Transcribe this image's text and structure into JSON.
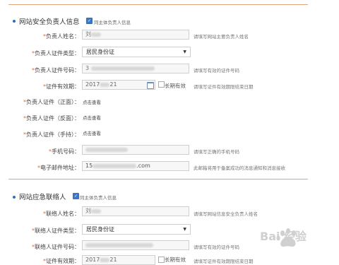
{
  "section1": {
    "title": "网站安全负责人信息",
    "checkbox_label": "同主体负责人信息",
    "fields": {
      "name": {
        "label": "负责人姓名：",
        "value": "刘",
        "hint": "请填写网站主要负责人姓名"
      },
      "id_type": {
        "label": "负责人证件类型：",
        "value": "居民身份证"
      },
      "id_number": {
        "label": "负责人证件号码：",
        "value": "3",
        "hint": "请填写有效的证件号码"
      },
      "valid_until": {
        "label": "证件有效期：",
        "value": "2017",
        "value_suffix": "21",
        "long_term_label": "长期有效",
        "hint": "请填写证件有效期限结束日期"
      },
      "id_front": {
        "label": "负责人证件（正面）：",
        "link": "点击查看"
      },
      "id_back": {
        "label": "负责人证件（反面）：",
        "link": "点击查看"
      },
      "id_hand": {
        "label": "负责人证件（手持）：",
        "link": "点击查看"
      },
      "phone": {
        "label": "手机号码：",
        "hint": "请填写正确的手机号码"
      },
      "email": {
        "label": "电子邮件地址：",
        "value_prefix": "15",
        "value_suffix": ".com",
        "hint": "此邮箱将用于备案成功的消息通知和消息接收"
      }
    }
  },
  "section2": {
    "title": "网站应急联络人",
    "checkbox_label": "同主体负责人信息",
    "fields": {
      "name": {
        "label": "联络人姓名：",
        "value": "刘",
        "hint": "请填写网站信息安全负责人姓名"
      },
      "id_type": {
        "label": "联络人证件类型：",
        "value": "居民身份证"
      },
      "id_number": {
        "label": "联络人证件号码：",
        "hint": "请填写有效的证件号码"
      },
      "valid_until": {
        "label": "证件有效期：",
        "value": "2017",
        "value_suffix": "21",
        "long_term_label": "长期有效",
        "hint": "请填写证件有效期限结束日期"
      }
    }
  },
  "required_mark": "*",
  "checkmark": "✓",
  "dropdown_arrow": "▼",
  "watermark_text": "Bai 经验",
  "colors": {
    "accent_line": "#e7a37d",
    "required": "#e8663c",
    "bullet": "#2a6fb8"
  }
}
